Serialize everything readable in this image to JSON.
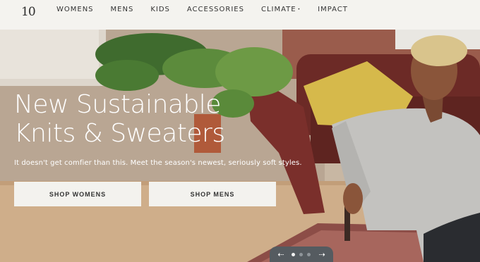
{
  "nav": {
    "logo_text": "10",
    "items": [
      {
        "label": "WOMENS"
      },
      {
        "label": "MENS"
      },
      {
        "label": "KIDS"
      },
      {
        "label": "ACCESSORIES"
      },
      {
        "label": "CLIMATE",
        "has_dropdown": true
      },
      {
        "label": "IMPACT"
      }
    ],
    "caret": "•"
  },
  "hero": {
    "title_line1": "New Sustainable",
    "title_line2": "Knits & Sweaters",
    "subtitle": "It doesn't get comfier than this. Meet the season's newest, seriously soft styles.",
    "buttons": [
      {
        "label": "SHOP WOMENS"
      },
      {
        "label": "SHOP MENS"
      }
    ],
    "carousel": {
      "prev": "⇠",
      "next": "⇢",
      "slides": 3,
      "active": 0
    }
  },
  "colors": {
    "nav_bg": "#f4f3ef",
    "button_bg": "#f3f2ee",
    "text_dark": "#333333"
  }
}
